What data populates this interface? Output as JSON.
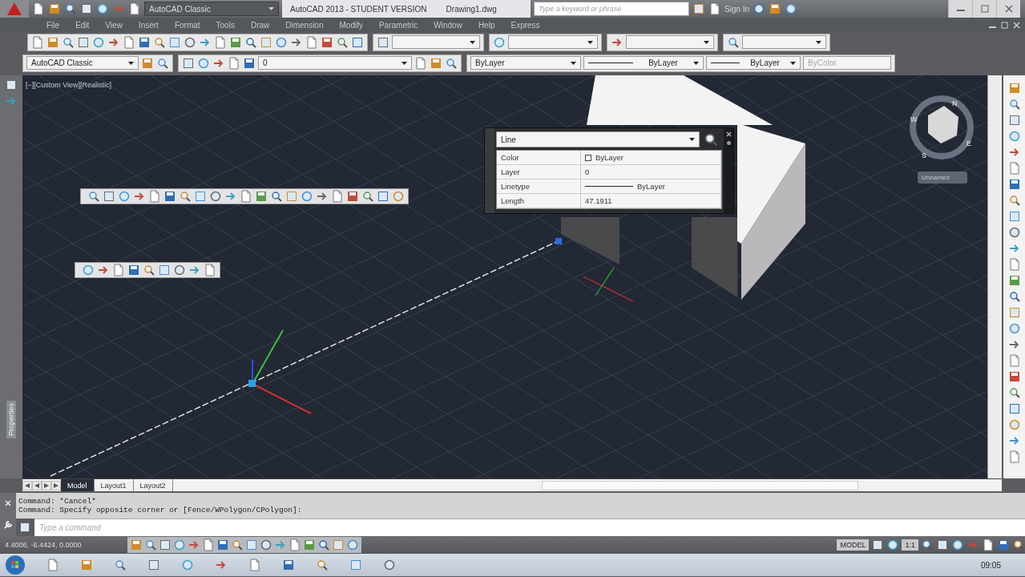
{
  "title_bar": {
    "workspace": "AutoCAD Classic",
    "title": "AutoCAD 2013 - STUDENT VERSION",
    "document": "Drawing1.dwg",
    "search": {
      "placeholder": "Type a keyword or phrase"
    },
    "sign_in": "Sign In"
  },
  "menu": [
    "File",
    "Edit",
    "View",
    "Insert",
    "Format",
    "Tools",
    "Draw",
    "Dimension",
    "Modify",
    "Parametric",
    "Window",
    "Help",
    "Express"
  ],
  "properties_toolbar": {
    "workspace": "AutoCAD Classic",
    "layer": "0",
    "color_control": "ByLayer",
    "linetype": "ByLayer",
    "lineweight": "ByLayer",
    "plot_style": {
      "value": "ByColor",
      "disabled": true
    }
  },
  "palette": {
    "label": "Properties"
  },
  "viewport": {
    "label": "[−][Custom View][Realistic]",
    "compass": [
      "N",
      "E",
      "S",
      "W"
    ],
    "coordinate_system": "Unnamed"
  },
  "quick_properties": {
    "object_type": "Line",
    "rows": [
      {
        "name": "Color",
        "value": "ByLayer",
        "kind": "color"
      },
      {
        "name": "Layer",
        "value": "0",
        "kind": "text"
      },
      {
        "name": "Linetype",
        "value": "ByLayer",
        "kind": "linetype"
      },
      {
        "name": "Length",
        "value": "47.1911",
        "kind": "text"
      }
    ]
  },
  "layout_tabs": [
    {
      "label": "Model",
      "selected": true
    },
    {
      "label": "Layout1",
      "selected": false
    },
    {
      "label": "Layout2",
      "selected": false
    }
  ],
  "command_history": [
    "Command: *Cancel*",
    "Command: Specify opposite corner or [Fence/WPolygon/CPolygon]:"
  ],
  "command_input": {
    "placeholder": "Type a command"
  },
  "status_bar": {
    "coordinates": "4.4006, -6.4424, 0.0000",
    "space": "MODEL",
    "scale": "1:1"
  },
  "taskbar": {
    "clock": "09:05"
  }
}
